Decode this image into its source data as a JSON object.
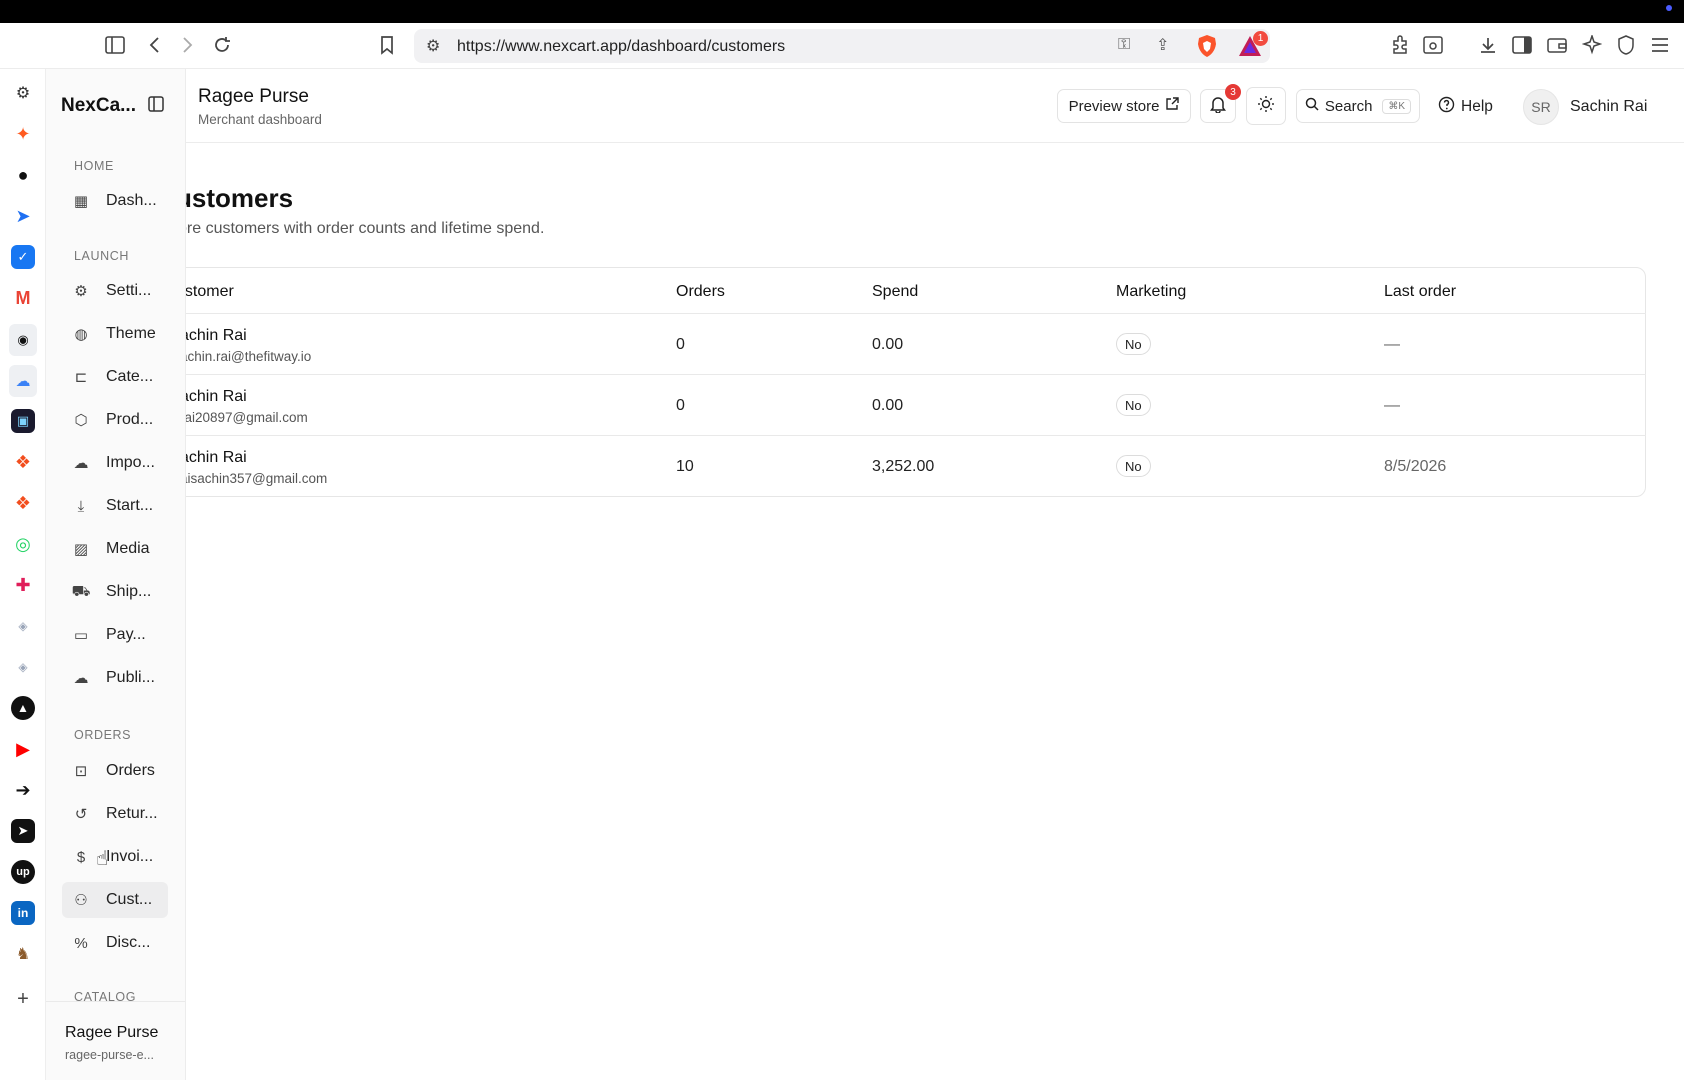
{
  "browser": {
    "url": "https://www.nexcart.app/dashboard/customers",
    "rewards_badge": "1"
  },
  "sidebar": {
    "brand": "NexCa...",
    "sections": {
      "home": "HOME",
      "launch": "LAUNCH",
      "orders": "ORDERS",
      "catalog": "CATALOG"
    },
    "items": {
      "dashboard": "Dash...",
      "settings": "Setti...",
      "theme": "Theme",
      "categories": "Cate...",
      "products": "Prod...",
      "import": "Impo...",
      "starter": "Start...",
      "media": "Media",
      "shipping": "Ship...",
      "payments": "Pay...",
      "publish": "Publi...",
      "orders": "Orders",
      "returns": "Retur...",
      "invoices": "Invoi...",
      "customers": "Cust...",
      "discounts": "Disc..."
    },
    "footer": {
      "store_name": "Ragee Purse",
      "store_slug": "ragee-purse-e..."
    }
  },
  "header": {
    "title": "Ragee Purse",
    "subtitle": "Merchant dashboard",
    "preview_label": "Preview store",
    "notif_count": "3",
    "search_label": "Search",
    "search_shortcut": "⌘K",
    "help_label": "Help",
    "avatar_initials": "SR",
    "user_name": "Sachin Rai"
  },
  "main": {
    "title": "ustomers",
    "description": "ore customers with order counts and lifetime spend.",
    "columns": {
      "customer": "ustomer",
      "orders": "Orders",
      "spend": "Spend",
      "marketing": "Marketing",
      "last_order": "Last order"
    },
    "rows": [
      {
        "name": "achin Rai",
        "email": "achin.rai@thefitway.io",
        "orders": "0",
        "spend": "0.00",
        "marketing": "No",
        "last_order": "—"
      },
      {
        "name": "achin Rai",
        "email": "rai20897@gmail.com",
        "orders": "0",
        "spend": "0.00",
        "marketing": "No",
        "last_order": "—"
      },
      {
        "name": "achin Rai",
        "email": "aisachin357@gmail.com",
        "orders": "10",
        "spend": "3,252.00",
        "marketing": "No",
        "last_order": "8/5/2026"
      }
    ]
  },
  "colors": {
    "accent_red": "#e53935",
    "active_bg": "#ededee"
  }
}
